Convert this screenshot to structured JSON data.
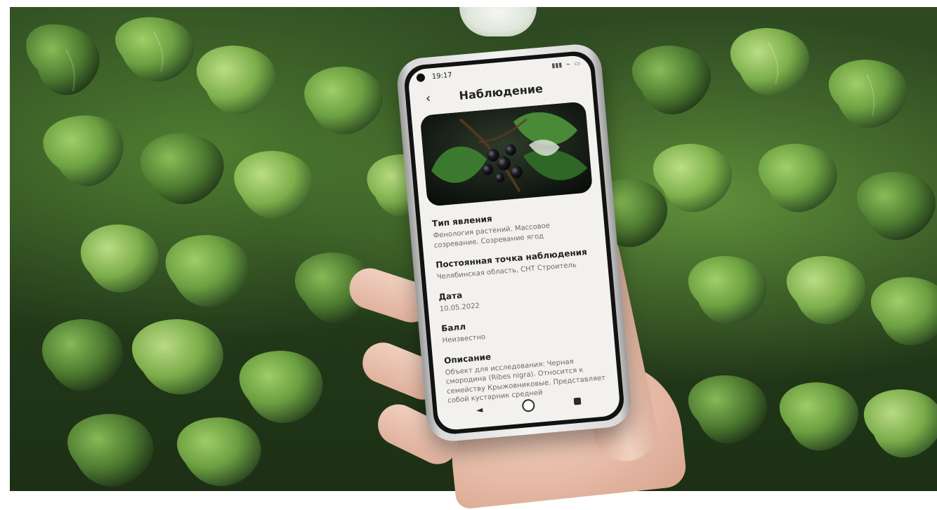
{
  "app": {
    "status_bar": {
      "time": "19:17",
      "icons": [
        "signal-icon",
        "wifi-icon",
        "battery-icon"
      ]
    },
    "header": {
      "title": "Наблюдение"
    },
    "sections": [
      {
        "heading": "Тип явления",
        "text": "Фенология растений. Массовое созревание. Созревание ягод"
      },
      {
        "heading": "Постоянная точка наблюдения",
        "text": "Челябинская область, СНТ Строитель"
      },
      {
        "heading": "Дата",
        "text": "10.05.2022"
      },
      {
        "heading": "Балл",
        "text": "Неизвестно"
      },
      {
        "heading": "Описание",
        "text": "Объект для исследования: Черная смородина (Ribes nigra). Относится к семейству Крыжовниковые. Представляет собой кустарник средней"
      }
    ],
    "navigation": {
      "back": "◄",
      "home": "●",
      "recent": "■"
    }
  },
  "colors": {
    "leaf_light": "#7fb24c",
    "leaf_mid": "#5f8f3a",
    "leaf_dark": "#2f4a22",
    "screen_bg": "#f3f1ee",
    "text_primary": "#1f1f1f",
    "text_secondary": "#6c6c6c",
    "skin": "#e6bba7"
  }
}
